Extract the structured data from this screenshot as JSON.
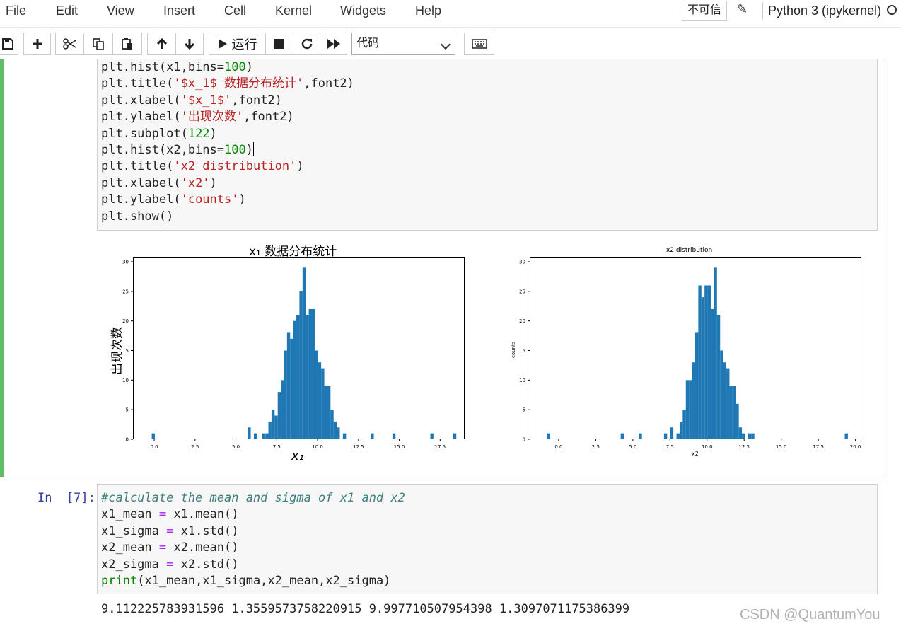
{
  "menubar": {
    "items": [
      "File",
      "Edit",
      "View",
      "Insert",
      "Cell",
      "Kernel",
      "Widgets",
      "Help"
    ],
    "trust_label": "不可信",
    "kernel_name": "Python 3 (ipykernel)"
  },
  "toolbar": {
    "run_label": "运行",
    "cell_type": "代码",
    "buttons": [
      "save-icon",
      "add-cell-icon",
      "cut-icon",
      "copy-icon",
      "paste-icon",
      "move-up-icon",
      "move-down-icon",
      "run-icon",
      "stop-icon",
      "restart-icon",
      "fast-forward-icon",
      "keyboard-icon"
    ]
  },
  "cell1": {
    "code_lines": [
      [
        [
          "plt.hist(x1,bins=",
          ""
        ],
        [
          "100",
          "num"
        ],
        [
          ")",
          ""
        ]
      ],
      [
        [
          "plt.title(",
          ""
        ],
        [
          "'$x_1$ 数据分布统计'",
          "str"
        ],
        [
          ",font2)",
          ""
        ]
      ],
      [
        [
          "plt.xlabel(",
          ""
        ],
        [
          "'$x_1$'",
          "str"
        ],
        [
          ",font2)",
          ""
        ]
      ],
      [
        [
          "plt.ylabel(",
          ""
        ],
        [
          "'出现次数'",
          "str"
        ],
        [
          ",font2)",
          ""
        ]
      ],
      [
        [
          "plt.subplot(",
          ""
        ],
        [
          "122",
          "num"
        ],
        [
          ")",
          ""
        ]
      ],
      [
        [
          "plt.hist(x2,bins=",
          ""
        ],
        [
          "100",
          "num"
        ],
        [
          ")",
          ""
        ]
      ],
      [
        [
          "plt.title(",
          ""
        ],
        [
          "'x2 distribution'",
          "str"
        ],
        [
          ")",
          ""
        ]
      ],
      [
        [
          "plt.xlabel(",
          ""
        ],
        [
          "'x2'",
          "str"
        ],
        [
          ")",
          ""
        ]
      ],
      [
        [
          "plt.ylabel(",
          ""
        ],
        [
          "'counts'",
          "str"
        ],
        [
          ")",
          ""
        ]
      ],
      [
        [
          "plt.show()",
          ""
        ]
      ]
    ]
  },
  "chart_data": [
    {
      "type": "bar",
      "title": "x₁ 数据分布统计",
      "xlabel": "x₁",
      "ylabel": "出现次数",
      "xlim": [
        -1.3,
        19.0
      ],
      "ylim": [
        0,
        30
      ],
      "xticks": [
        "0.0",
        "2.5",
        "5.0",
        "7.5",
        "10.0",
        "12.5",
        "15.0",
        "17.5"
      ],
      "yticks": [
        "0",
        "5",
        "10",
        "15",
        "20",
        "25",
        "30"
      ],
      "bin_width": 0.19,
      "color": "#1f77b4",
      "bins": [
        [
          -0.15,
          1
        ],
        [
          5.72,
          2
        ],
        [
          6.1,
          1
        ],
        [
          6.6,
          1
        ],
        [
          6.8,
          1
        ],
        [
          6.99,
          3
        ],
        [
          7.18,
          5
        ],
        [
          7.37,
          4
        ],
        [
          7.56,
          8
        ],
        [
          7.75,
          10
        ],
        [
          7.94,
          15
        ],
        [
          8.13,
          18
        ],
        [
          8.32,
          17
        ],
        [
          8.51,
          20
        ],
        [
          8.7,
          21
        ],
        [
          8.89,
          25
        ],
        [
          9.08,
          29
        ],
        [
          9.27,
          21
        ],
        [
          9.46,
          22
        ],
        [
          9.65,
          22
        ],
        [
          9.84,
          15
        ],
        [
          10.03,
          13
        ],
        [
          10.22,
          12
        ],
        [
          10.41,
          9
        ],
        [
          10.6,
          9
        ],
        [
          10.79,
          5
        ],
        [
          10.98,
          3
        ],
        [
          11.17,
          2
        ],
        [
          11.55,
          1
        ],
        [
          13.25,
          1
        ],
        [
          14.58,
          1
        ],
        [
          16.9,
          1
        ],
        [
          18.3,
          1
        ]
      ]
    },
    {
      "type": "bar",
      "title": "x2 distribution",
      "xlabel": "x2",
      "ylabel": "counts",
      "xlim": [
        -1.95,
        20.4
      ],
      "ylim": [
        0,
        30
      ],
      "xticks": [
        "0.0",
        "2.5",
        "5.0",
        "7.5",
        "10.0",
        "12.5",
        "15.0",
        "17.5",
        "20.0"
      ],
      "yticks": [
        "0",
        "5",
        "10",
        "15",
        "20",
        "25",
        "30"
      ],
      "bin_width": 0.21,
      "color": "#1f77b4",
      "bins": [
        [
          -0.78,
          1
        ],
        [
          4.18,
          1
        ],
        [
          5.4,
          1
        ],
        [
          7.1,
          1
        ],
        [
          7.52,
          2
        ],
        [
          7.94,
          1
        ],
        [
          8.15,
          3
        ],
        [
          8.36,
          5
        ],
        [
          8.57,
          10
        ],
        [
          8.78,
          10
        ],
        [
          8.99,
          13
        ],
        [
          9.2,
          18
        ],
        [
          9.41,
          26
        ],
        [
          9.62,
          24
        ],
        [
          9.83,
          26
        ],
        [
          10.04,
          26
        ],
        [
          10.25,
          22
        ],
        [
          10.46,
          29
        ],
        [
          10.67,
          21
        ],
        [
          10.88,
          15
        ],
        [
          11.09,
          13
        ],
        [
          11.3,
          12
        ],
        [
          11.51,
          9
        ],
        [
          11.72,
          9
        ],
        [
          11.93,
          6
        ],
        [
          12.14,
          2
        ],
        [
          12.35,
          1
        ],
        [
          12.77,
          1
        ],
        [
          12.98,
          1
        ],
        [
          19.28,
          1
        ]
      ]
    }
  ],
  "cell2": {
    "prompt": "In  [7]:",
    "code_lines": [
      [
        [
          "#calculate the mean and sigma of x1 and x2",
          "cm"
        ]
      ],
      [
        [
          "x1_mean ",
          ""
        ],
        [
          "=",
          "op"
        ],
        [
          " x1.mean()",
          ""
        ]
      ],
      [
        [
          "x1_sigma ",
          ""
        ],
        [
          "=",
          "op"
        ],
        [
          " x1.std()",
          ""
        ]
      ],
      [
        [
          "x2_mean ",
          ""
        ],
        [
          "=",
          "op"
        ],
        [
          " x2.mean()",
          ""
        ]
      ],
      [
        [
          "x2_sigma ",
          ""
        ],
        [
          "=",
          "op"
        ],
        [
          " x2.std()",
          ""
        ]
      ],
      [
        [
          "print",
          "kw"
        ],
        [
          "(x1_mean,x1_sigma,x2_mean,x2_sigma)",
          ""
        ]
      ]
    ],
    "output": "9.112225783931596 1.3559573758220915 9.997710507954398 1.3097071175386399"
  },
  "watermark": "CSDN @QuantumYou"
}
